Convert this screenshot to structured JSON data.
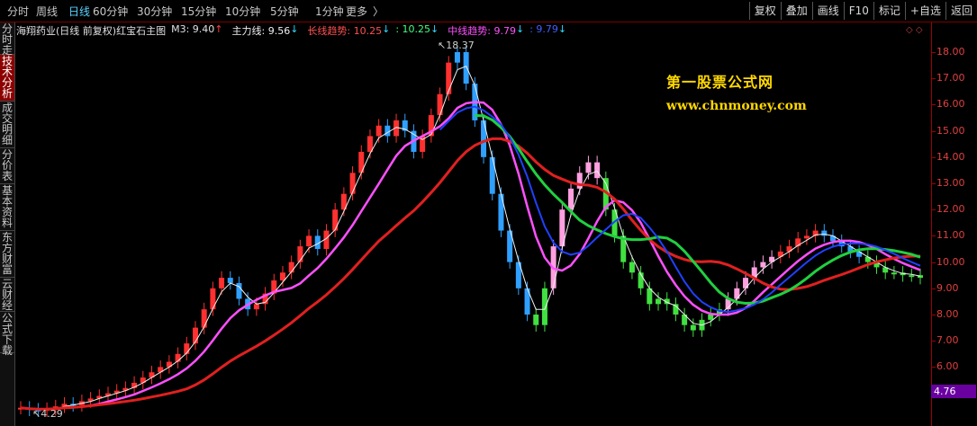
{
  "periods": [
    "分时",
    "周线",
    "日线",
    "60分钟",
    "30分钟",
    "15分钟",
    "10分钟",
    "5分钟",
    "1分钟",
    "更多"
  ],
  "active_period": "日线",
  "more_arrow": "〉",
  "toolbar": [
    "复权",
    "叠加",
    "画线",
    "F10",
    "标记",
    "+自选",
    "返回"
  ],
  "sidebar": [
    "分时走势",
    "技术分析",
    "成交明细",
    "分价表",
    "基本资料",
    "东方财富",
    "云财经",
    "公式下载"
  ],
  "active_sidebar": "技术分析",
  "info": {
    "title": "海翔药业(日线 前复权)红宝石主图",
    "m3_label": "M3: 9.40",
    "m3_arrow": "↑",
    "main_label": "主力线: 9.56",
    "main_arrow": "↓",
    "long_label": "长线趋势: 10.25",
    "long_arrow": "↓",
    "long2": ": 10.25",
    "long2_arrow": "↓",
    "mid_label": "中线趋势: 9.79",
    "mid_arrow": "↓",
    "mid2": ": 9.79",
    "mid2_arrow": "↓"
  },
  "colors": {
    "m3": "#ff4040",
    "main": "#f0f0f0",
    "long": "#ff5050",
    "long2": "#40ff80",
    "mid": "#ff50ff",
    "mid2": "#4060ff",
    "up": "#ff5050",
    "down": "#30d8ff"
  },
  "y_axis": {
    "ticks": [
      "18.00",
      "17.00",
      "16.00",
      "15.00",
      "14.00",
      "13.00",
      "12.00",
      "11.00",
      "10.00",
      "9.00",
      "8.00",
      "7.00",
      "6.00",
      "5.00"
    ],
    "current": "4.76"
  },
  "annotations": {
    "high": "18.37",
    "low": "4.29"
  },
  "watermark": {
    "line1": "第一股票公式网",
    "line2": "www.chnmoney.com"
  },
  "corner_icons": "◇ ◇",
  "chart_data": {
    "type": "candlestick",
    "ylim": [
      5,
      18.5
    ],
    "series": [
      {
        "name": "close",
        "values": [
          4.45,
          4.38,
          4.35,
          4.4,
          4.5,
          4.6,
          4.55,
          4.7,
          4.8,
          4.9,
          5.0,
          5.1,
          5.2,
          5.4,
          5.6,
          5.8,
          6.0,
          6.2,
          6.5,
          6.9,
          7.5,
          8.2,
          9.0,
          9.4,
          9.2,
          8.6,
          8.2,
          8.4,
          8.8,
          9.3,
          9.6,
          10.0,
          10.6,
          11.0,
          10.5,
          11.2,
          12.0,
          12.6,
          13.4,
          14.2,
          14.8,
          15.2,
          14.8,
          15.4,
          15.0,
          14.2,
          14.8,
          15.6,
          16.4,
          17.6,
          18.0,
          16.8,
          15.4,
          14.0,
          12.6,
          11.2,
          10.0,
          9.0,
          8.0,
          7.6,
          9.0,
          10.6,
          12.0,
          12.8,
          13.4,
          13.8,
          13.2,
          12.0,
          11.0,
          10.0,
          9.6,
          9.0,
          8.4,
          8.6,
          8.4,
          8.0,
          7.6,
          7.4,
          7.8,
          8.0,
          8.2,
          8.6,
          9.0,
          9.4,
          9.8,
          10.0,
          10.2,
          10.4,
          10.6,
          10.9,
          11.0,
          11.2,
          11.0,
          10.8,
          10.6,
          10.4,
          10.2,
          10.0,
          9.8,
          9.6,
          9.6,
          9.5,
          9.5,
          9.4
        ]
      }
    ]
  }
}
